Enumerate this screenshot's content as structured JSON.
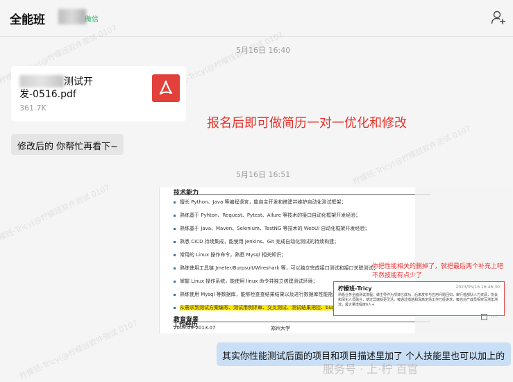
{
  "header": {
    "title": "全能班",
    "wx_tag": "微信"
  },
  "messages": {
    "time1": "5月16日 16:40",
    "file": {
      "name_line1": "测试开",
      "name_line2": "发-0516.pdf",
      "size": "361.7K"
    },
    "promo_text": "报名后即可做简历一对一优化和修改",
    "text1": "修改后的 你帮忙再看下~",
    "time2": "5月16日 16:51",
    "resume": {
      "skills_title": "技术能力",
      "skills": [
        "擅长 Python、Java 等编程语言，能自主开发和搭建并维护自动化测试框架；",
        "熟练基于 Pyhton、Request、Pytest、Allure 等技术的接口自动化框架开发经验；",
        "熟练基于 Java、Maven、Selenium、TestNG 等技术的 WebUI 自动化框架开发经验；",
        "熟悉 CICD 持续集成，能使用 Jenkins、Git 完成自动化测试的持续构建；",
        "常用的 Linux 操作命令，熟悉 Mysql 相关知识；",
        "熟练使用工具链 Jmeter/Burpsuit/Wireshark 等，可以独立完成接口测试和接口关联测试；",
        "掌握 Linux 操作系统，能使用 linux 命令并独立搭建测试环境；",
        "熟练使用 Mysql 等数据库，能够检查查结果结果以及进行数据库性能瓶颈的分析；",
        "从需求到测试方案编写、测试用例评审、交叉测试、测试结果把控、bug 分析等"
      ],
      "edu_title": "教育背景",
      "edu_date": "2009.09-2013.07",
      "edu_school": "郑州大学",
      "work_title": "工作经历",
      "red_note": "你把性能相关的删掉了，就把最后两个补充上吧 不然技能有点少了",
      "comment_user": "柠檬班-Tricy",
      "comment_date": "2023/05/16 16:46:30",
      "comment_body": "熟悉业务全面测试流程，做主导作为项目已成功，后来发布与应用问题回归，审行值部队人力资源，协会和深化人员融合，使过异端就更灵活，被通过措培和深高定场工作已经讲求，策也对产成员相实写测年测流，最大量增幅度6人+"
    },
    "self_text": "其实你性能测试后面的项目和项目描述里加了 个人技能里也可以加上的",
    "brand": "服务号 · 上·柠 百官"
  },
  "watermark": "柠檬班-Tricy(@柠檬班软件测试 0107",
  "colors": {
    "promo": "#e8322a",
    "self_bubble": "#c9dff6",
    "pdf_red": "#e2403a",
    "highlight": "#ffe800"
  }
}
